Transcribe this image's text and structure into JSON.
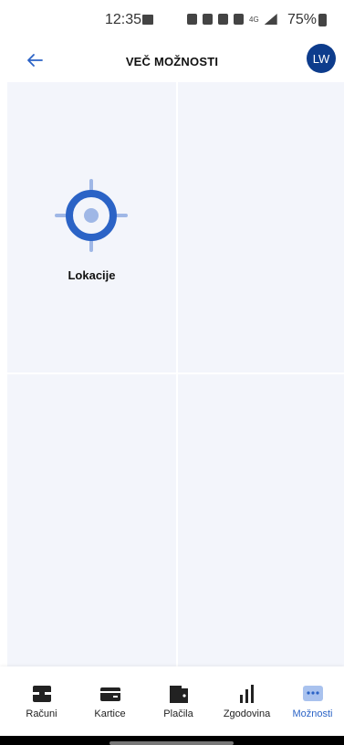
{
  "status_bar": {
    "time": "12:35",
    "network": "4G",
    "battery": "75%"
  },
  "header": {
    "title": "VEČ MOŽNOSTI",
    "avatar_initials": "LW",
    "avatar_color": "#0d3c8c"
  },
  "grid": {
    "tiles": [
      {
        "label": "Lokacije",
        "icon": "location-target-icon"
      }
    ]
  },
  "tabs": [
    {
      "label": "Računi",
      "icon": "account-icon",
      "active": false
    },
    {
      "label": "Kartice",
      "icon": "card-icon",
      "active": false
    },
    {
      "label": "Plačila",
      "icon": "wallet-icon",
      "active": false
    },
    {
      "label": "Zgodovina",
      "icon": "bar-chart-icon",
      "active": false
    },
    {
      "label": "Možnosti",
      "icon": "more-icon",
      "active": true
    }
  ],
  "colors": {
    "accent": "#2b63c6",
    "grid_bg": "#f3f5fb",
    "active_tab": "#2b63c6"
  }
}
